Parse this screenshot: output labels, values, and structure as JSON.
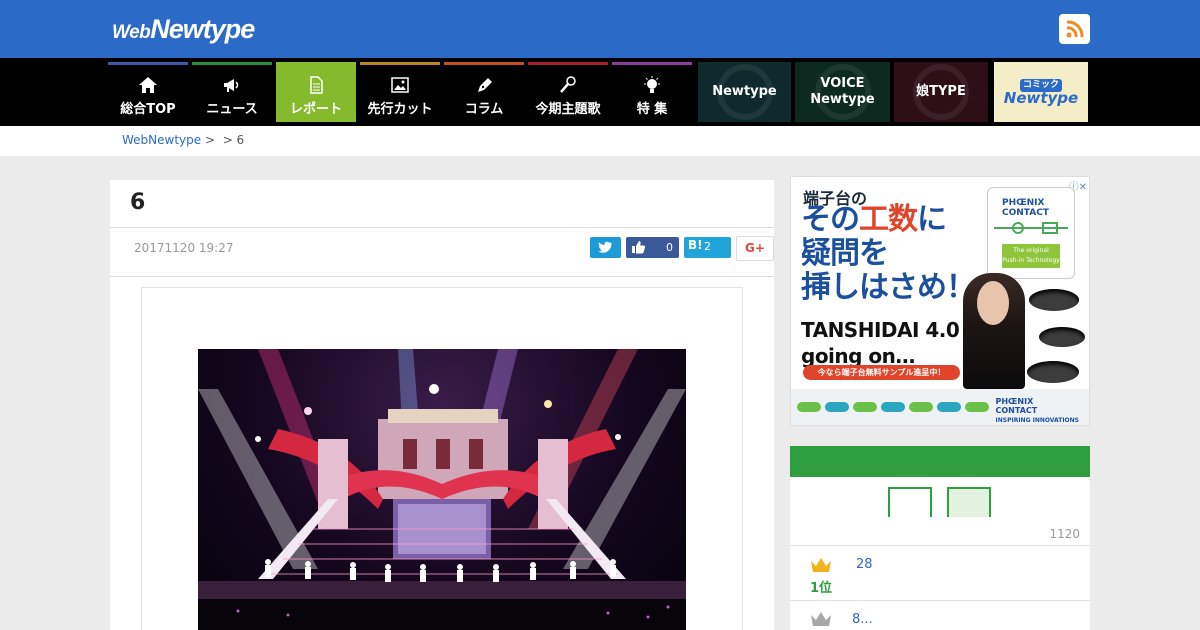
{
  "header": {
    "logo_web": "Web",
    "logo_newtype": "Newtype",
    "rss_icon": "rss-icon"
  },
  "nav": {
    "items": [
      {
        "label": "総合TOP",
        "icon": "home-icon",
        "color": "#3d5aa8"
      },
      {
        "label": "ニュース",
        "icon": "megaphone-icon",
        "color": "#2f8a3a"
      },
      {
        "label": "レポート",
        "icon": "document-icon",
        "color": "#85ba2c",
        "active": true
      },
      {
        "label": "先行カット",
        "icon": "image-icon",
        "color": "#b98b1c"
      },
      {
        "label": "コラム",
        "icon": "pen-icon",
        "color": "#c2521b"
      },
      {
        "label": "今期主題歌",
        "icon": "microphone-icon",
        "color": "#a81e2c"
      },
      {
        "label": "特 集",
        "icon": "lightbulb-icon",
        "color": "#8a3d9c"
      }
    ],
    "banners": [
      {
        "label": "Newtype"
      },
      {
        "label_line1": "VOICE",
        "label_line2": "Newtype"
      },
      {
        "label": "娘TYPE"
      },
      {
        "label_small": "コミック",
        "label": "Newtype"
      }
    ]
  },
  "breadcrumb": {
    "home": "WebNewtype",
    "sep1": ">",
    "sep2": "> 6"
  },
  "article": {
    "title": "6",
    "date": "20171120 19:27",
    "share": {
      "twitter_icon": "twitter-icon",
      "facebook_like_icon": "thumbs-up-icon",
      "facebook_count": "0",
      "hatena_label": "B!",
      "hatena_count": "2",
      "gplus_label": "G+"
    },
    "photo_description_icon": "concert-stage-photo"
  },
  "ad": {
    "line1": "端子台の",
    "line2_a": "その",
    "line2_b": "工数",
    "line2_c": "に",
    "line3": "疑問を",
    "line4": "挿しはさめ！",
    "line5": "TANSHIDAI 4.0",
    "line6": "going on…",
    "pill": "今なら端子台無料サンプル進呈中！",
    "brand": "PHŒNIX",
    "brand2": "CONTACT",
    "badge_line1": "The original",
    "badge_line2": "Push-in Technology",
    "tagline": "INSPIRING INNOVATIONS",
    "info_icon": "ad-info-icon"
  },
  "ranking": {
    "date": "1120",
    "items": [
      {
        "rank_label": "1位",
        "link": "28",
        "crown": "gold-crown-icon"
      },
      {
        "rank_label": "",
        "link": "8...",
        "crown": "silver-crown-icon"
      }
    ]
  }
}
